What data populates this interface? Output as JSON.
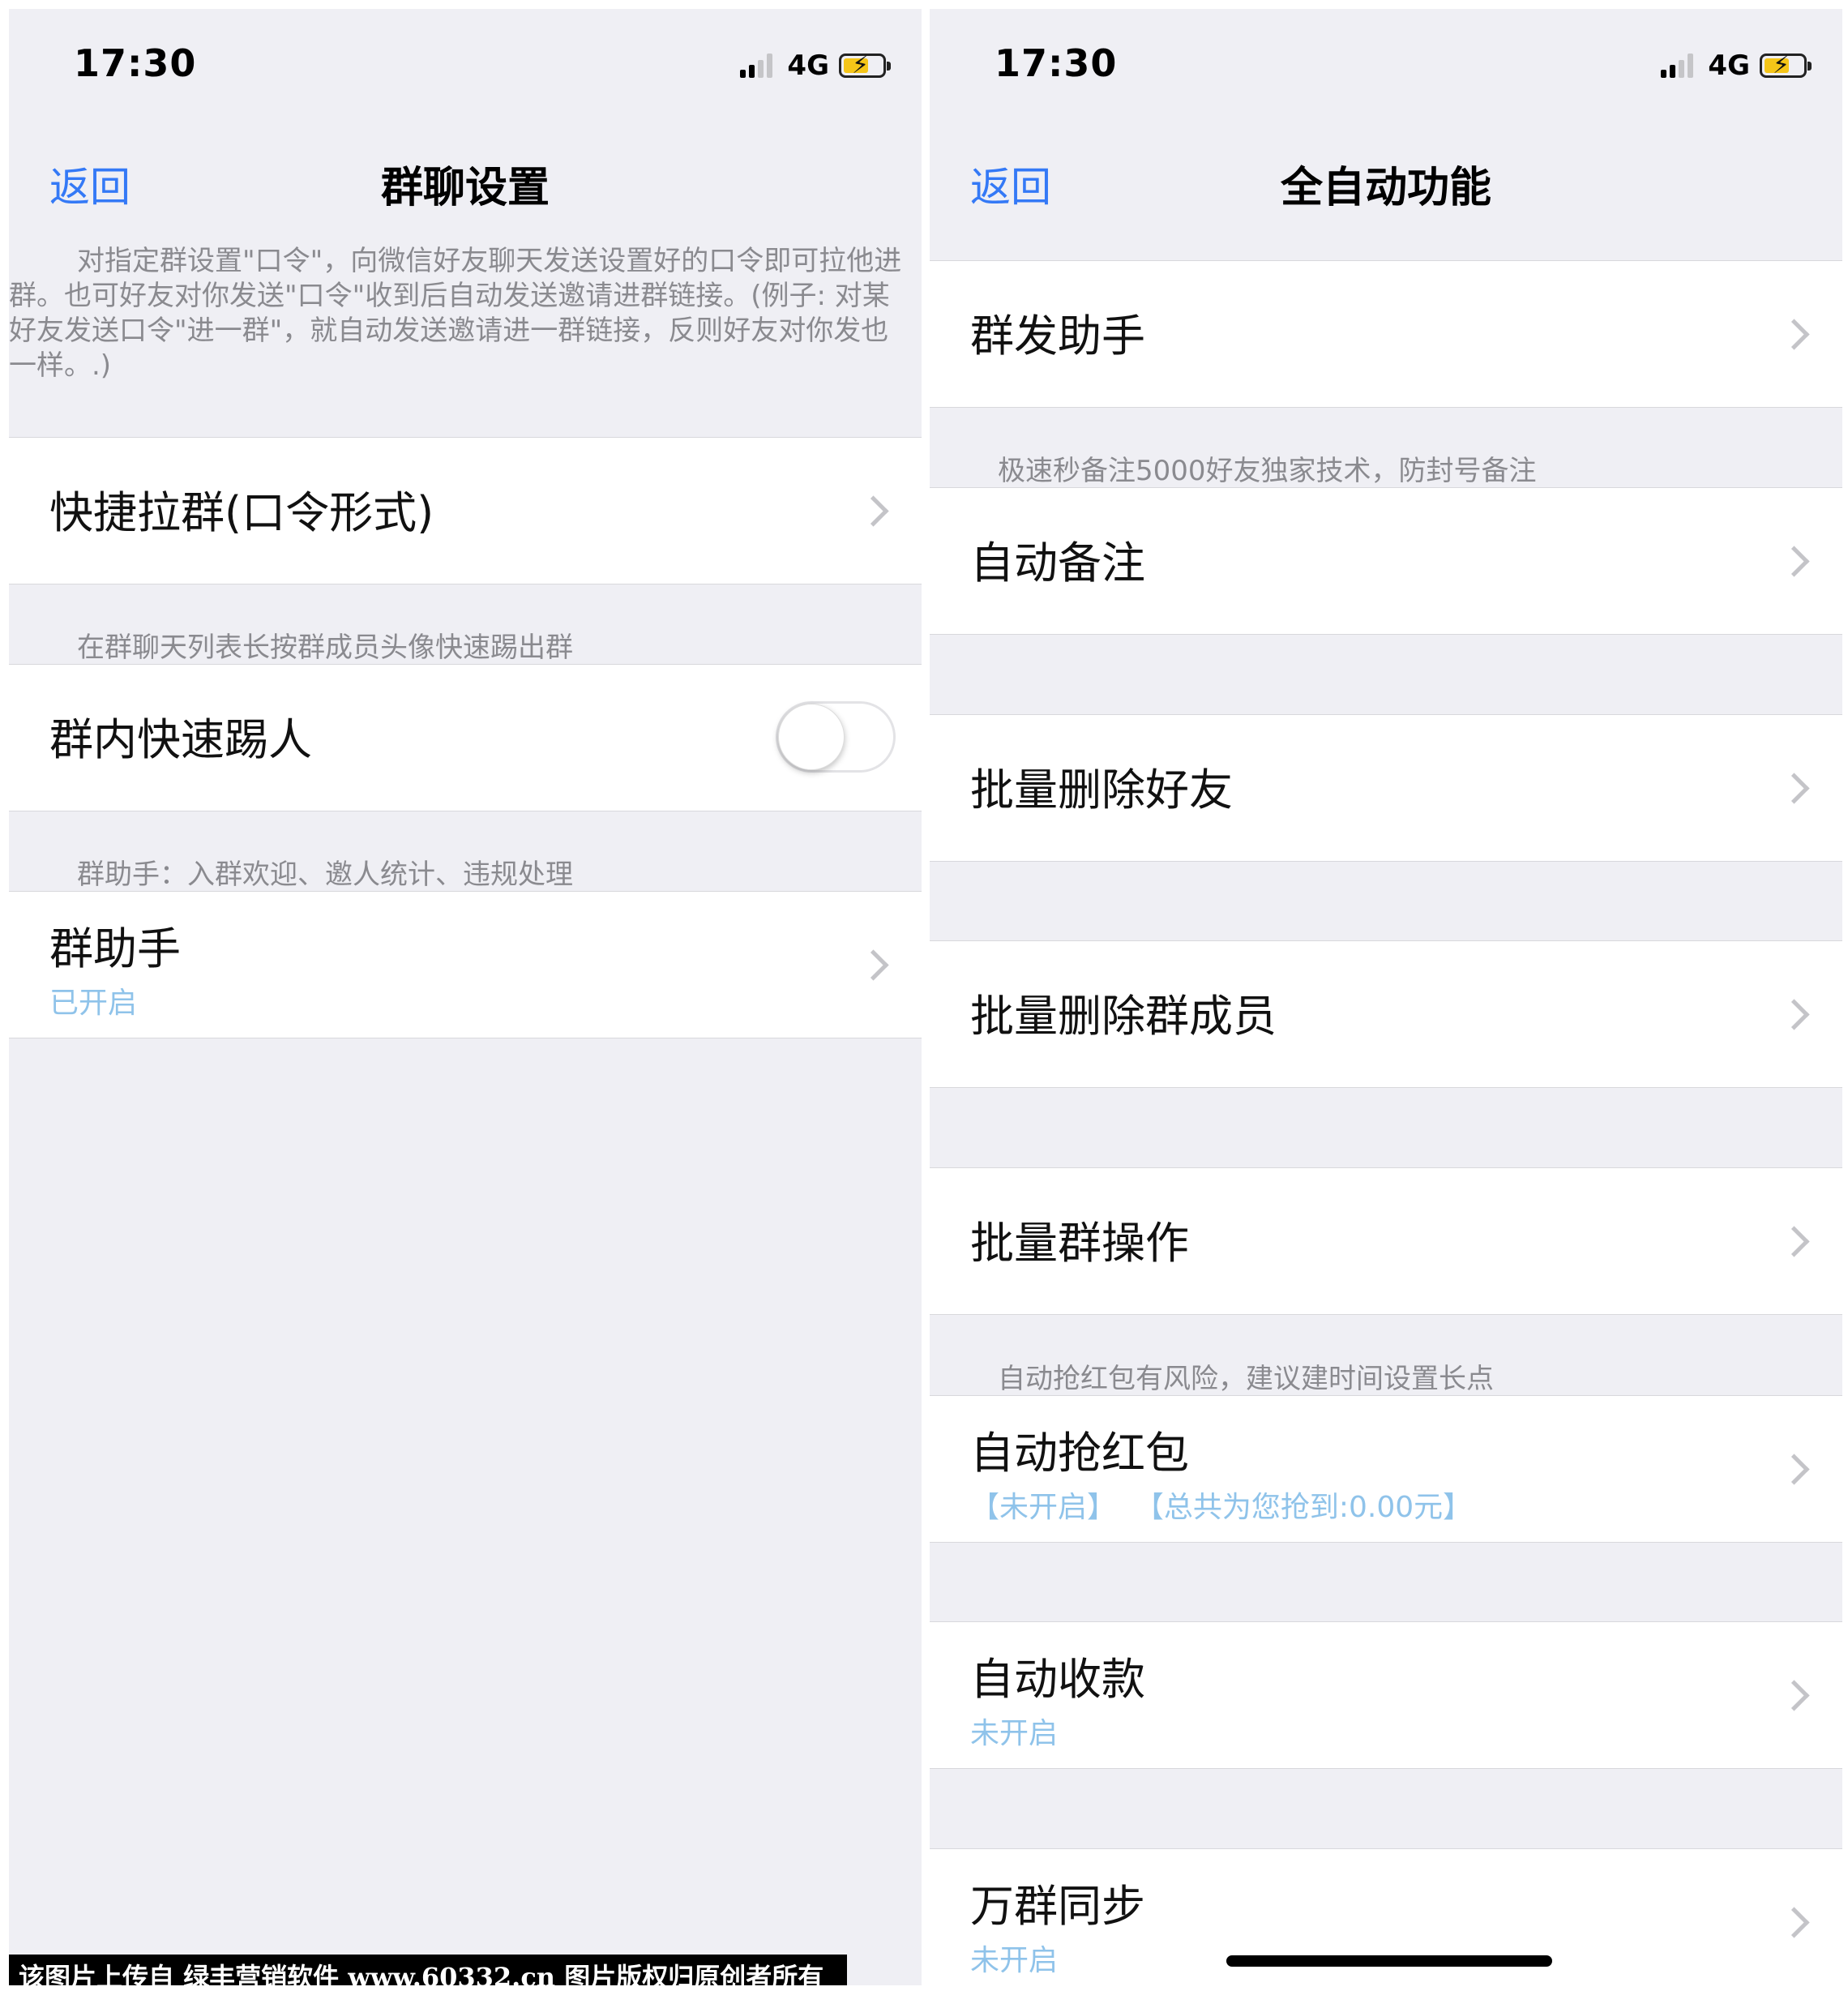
{
  "left": {
    "status": {
      "time": "17:30",
      "network": "4G"
    },
    "nav": {
      "back": "返回",
      "title": "群聊设置"
    },
    "description": "对指定群设置\"口令\"，向微信好友聊天发送设置好的口令即可拉他进群。也可好友对你发送\"口令\"收到后自动发送邀请进群链接。(例子: 对某好友发送口令\"进一群\"，就自动发送邀请进一群链接，反则好友对你发也一样。.)",
    "quick_pull": {
      "title": "快捷拉群(口令形式)"
    },
    "kick_note": "在群聊天列表长按群成员头像快速踢出群",
    "kick": {
      "title": "群内快速踢人",
      "enabled": false
    },
    "helper_note": "群助手：入群欢迎、邀人统计、违规处理",
    "helper": {
      "title": "群助手",
      "status": "已开启"
    }
  },
  "right": {
    "status": {
      "time": "17:30",
      "network": "4G"
    },
    "nav": {
      "back": "返回",
      "title": "全自动功能"
    },
    "items": [
      {
        "title": "群发助手"
      },
      {
        "note": "极速秒备注5000好友独家技术，防封号备注",
        "title": "自动备注"
      },
      {
        "title": "批量删除好友"
      },
      {
        "title": "批量删除群成员"
      },
      {
        "title": "批量群操作"
      },
      {
        "note": "自动抢红包有风险，建议建时间设置长点",
        "title": "自动抢红包",
        "status": "【未开启】  【总共为您抢到:0.00元】"
      },
      {
        "title": "自动收款",
        "status": "未开启"
      },
      {
        "title": "万群同步",
        "status": "未开启"
      }
    ]
  },
  "watermark": "该图片上传自 绿丰营销软件 www.60332.cn 图片版权归原创者所有",
  "colors": {
    "accent": "#3479f6",
    "status_text": "#8fc3ea",
    "background": "#efeff4",
    "battery": "#f5c518"
  }
}
